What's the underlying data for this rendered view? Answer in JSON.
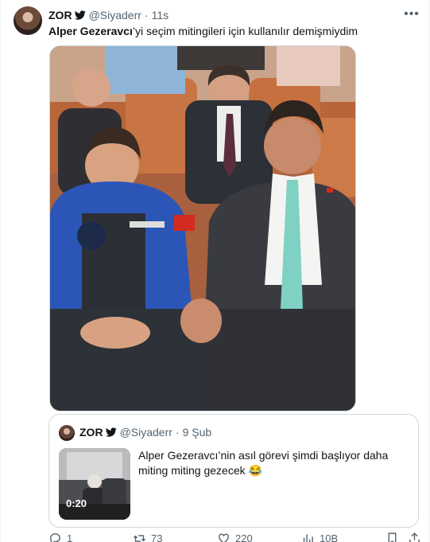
{
  "tweet": {
    "author_name": "ZOR",
    "handle": "@Siyaderr",
    "separator": "·",
    "time": "11s",
    "text_bold": "Alper Gezeravcı",
    "text_rest": "’yi seçim mitingileri için kullanılır  demişmiydim",
    "more_glyph": "•••"
  },
  "quote": {
    "author_name": "ZOR",
    "handle": "@Siyaderr",
    "separator": "·",
    "date": "9 Şub",
    "text": "Alper Gezeravcı’nin asıl görevi şimdi başlıyor daha miting miting gezecek 😂",
    "video_duration": "0:20"
  },
  "actions": [
    {
      "icon": "reply-icon",
      "count": "1"
    },
    {
      "icon": "retweet-icon",
      "count": "73"
    },
    {
      "icon": "like-icon",
      "count": "220"
    },
    {
      "icon": "views-icon",
      "count": "10B"
    }
  ],
  "colors": {
    "text": "#0f1419",
    "secondary": "#536471",
    "border": "#cfd9de",
    "verified": "#1d9bf0"
  }
}
